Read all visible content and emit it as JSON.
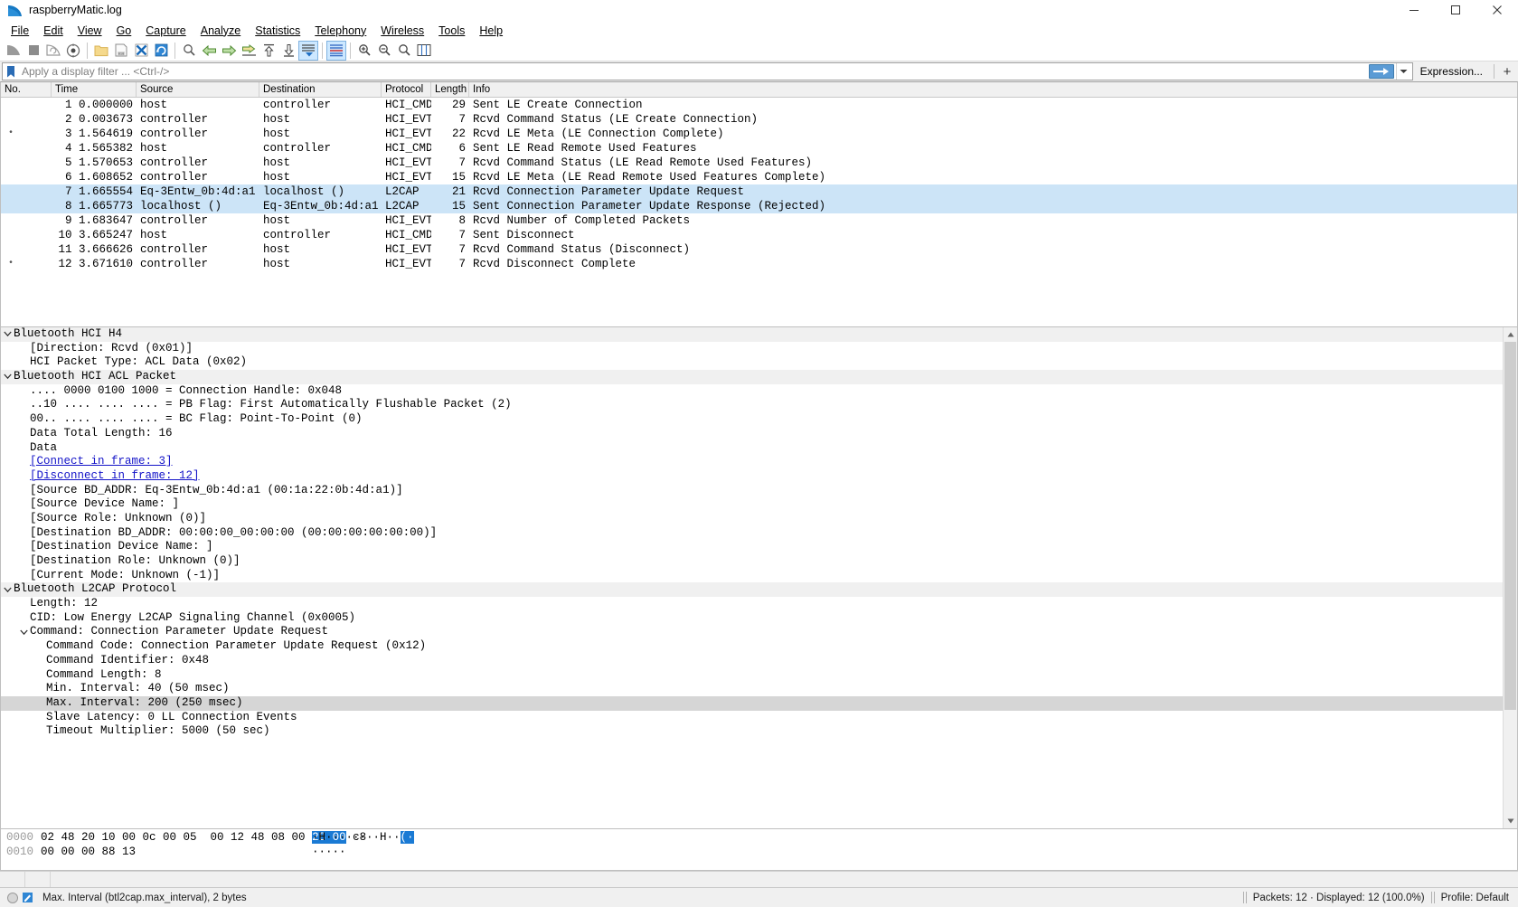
{
  "window": {
    "title": "raspberryMatic.log",
    "icon": "wireshark-shark-fin-icon",
    "minimize_label": "—",
    "maximize_label": "❑",
    "close_label": "✕"
  },
  "menu": {
    "items": [
      {
        "label": "File",
        "accel": "F"
      },
      {
        "label": "Edit",
        "accel": "E"
      },
      {
        "label": "View",
        "accel": "V"
      },
      {
        "label": "Go",
        "accel": "G"
      },
      {
        "label": "Capture",
        "accel": "C"
      },
      {
        "label": "Analyze",
        "accel": "A"
      },
      {
        "label": "Statistics",
        "accel": "S"
      },
      {
        "label": "Telephony",
        "accel": "T"
      },
      {
        "label": "Wireless",
        "accel": "W"
      },
      {
        "label": "Tools",
        "accel": "T"
      },
      {
        "label": "Help",
        "accel": "H"
      }
    ]
  },
  "toolbar": {
    "buttons": [
      {
        "name": "start-capture-icon",
        "title": "Start capturing packets"
      },
      {
        "name": "stop-capture-icon",
        "title": "Stop capturing packets"
      },
      {
        "name": "restart-capture-icon",
        "title": "Restart current capture"
      },
      {
        "name": "capture-options-icon",
        "title": "Capture options"
      },
      {
        "name": "open-file-icon",
        "title": "Open a capture file"
      },
      {
        "name": "save-file-icon",
        "title": "Save this capture file"
      },
      {
        "name": "close-file-icon",
        "title": "Close this capture file"
      },
      {
        "name": "reload-file-icon",
        "title": "Reload this file"
      },
      {
        "name": "find-packet-icon",
        "title": "Find a packet"
      },
      {
        "name": "go-back-icon",
        "title": "Go back in packet history"
      },
      {
        "name": "go-forward-icon",
        "title": "Go forward in packet history"
      },
      {
        "name": "go-to-packet-icon",
        "title": "Go to specific packet"
      },
      {
        "name": "go-first-packet-icon",
        "title": "Go to the first packet"
      },
      {
        "name": "go-last-packet-icon",
        "title": "Go to the last packet"
      },
      {
        "name": "auto-scroll-icon",
        "title": "Auto scroll in live capture"
      },
      {
        "name": "colorize-packets-icon",
        "title": "Colorize packet list"
      },
      {
        "name": "zoom-in-icon",
        "title": "Zoom in"
      },
      {
        "name": "zoom-out-icon",
        "title": "Zoom out"
      },
      {
        "name": "normal-size-icon",
        "title": "Normal size"
      },
      {
        "name": "resize-columns-icon",
        "title": "Resize columns"
      }
    ]
  },
  "filter": {
    "bookmark_icon": "filter-bookmark-icon",
    "placeholder": "Apply a display filter ... <Ctrl-/>",
    "value": "",
    "apply_icon": "apply-filter-arrow-icon",
    "dropdown_icon": "chevron-down-icon",
    "expression_label": "Expression...",
    "add_label": "+"
  },
  "packet_list": {
    "columns": [
      {
        "label": "No."
      },
      {
        "label": "Time"
      },
      {
        "label": "Source"
      },
      {
        "label": "Destination"
      },
      {
        "label": "Protocol"
      },
      {
        "label": "Length"
      },
      {
        "label": "Info"
      }
    ],
    "rows": [
      {
        "mark": "",
        "no": "1",
        "time": "0.000000",
        "source": "host",
        "destination": "controller",
        "protocol": "HCI_CMD",
        "length": "29",
        "info": "Sent LE Create Connection",
        "selected": false
      },
      {
        "mark": "",
        "no": "2",
        "time": "0.003673",
        "source": "controller",
        "destination": "host",
        "protocol": "HCI_EVT",
        "length": "7",
        "info": "Rcvd Command Status (LE Create Connection)",
        "selected": false
      },
      {
        "mark": "•",
        "no": "3",
        "time": "1.564619",
        "source": "controller",
        "destination": "host",
        "protocol": "HCI_EVT",
        "length": "22",
        "info": "Rcvd LE Meta (LE Connection Complete)",
        "selected": false
      },
      {
        "mark": "",
        "no": "4",
        "time": "1.565382",
        "source": "host",
        "destination": "controller",
        "protocol": "HCI_CMD",
        "length": "6",
        "info": "Sent LE Read Remote Used Features",
        "selected": false
      },
      {
        "mark": "",
        "no": "5",
        "time": "1.570653",
        "source": "controller",
        "destination": "host",
        "protocol": "HCI_EVT",
        "length": "7",
        "info": "Rcvd Command Status (LE Read Remote Used Features)",
        "selected": false
      },
      {
        "mark": "",
        "no": "6",
        "time": "1.608652",
        "source": "controller",
        "destination": "host",
        "protocol": "HCI_EVT",
        "length": "15",
        "info": "Rcvd LE Meta (LE Read Remote Used Features Complete)",
        "selected": false
      },
      {
        "mark": "",
        "no": "7",
        "time": "1.665554",
        "source": "Eq-3Entw_0b:4d:a1 ()",
        "destination": "localhost ()",
        "protocol": "L2CAP",
        "length": "21",
        "info": "Rcvd Connection Parameter Update Request",
        "selected": true
      },
      {
        "mark": "",
        "no": "8",
        "time": "1.665773",
        "source": "localhost ()",
        "destination": "Eq-3Entw_0b:4d:a1 ()",
        "protocol": "L2CAP",
        "length": "15",
        "info": "Sent Connection Parameter Update Response (Rejected)",
        "selected": true
      },
      {
        "mark": "",
        "no": "9",
        "time": "1.683647",
        "source": "controller",
        "destination": "host",
        "protocol": "HCI_EVT",
        "length": "8",
        "info": "Rcvd Number of Completed Packets",
        "selected": false
      },
      {
        "mark": "",
        "no": "10",
        "time": "3.665247",
        "source": "host",
        "destination": "controller",
        "protocol": "HCI_CMD",
        "length": "7",
        "info": "Sent Disconnect",
        "selected": false
      },
      {
        "mark": "",
        "no": "11",
        "time": "3.666626",
        "source": "controller",
        "destination": "host",
        "protocol": "HCI_EVT",
        "length": "7",
        "info": "Rcvd Command Status (Disconnect)",
        "selected": false
      },
      {
        "mark": "•",
        "no": "12",
        "time": "3.671610",
        "source": "controller",
        "destination": "host",
        "protocol": "HCI_EVT",
        "length": "7",
        "info": "Rcvd Disconnect Complete",
        "selected": false
      }
    ]
  },
  "packet_detail": {
    "rows": [
      {
        "indent": 0,
        "arrow": "expanded",
        "text": "Bluetooth HCI H4",
        "proto": true,
        "link": false,
        "sel": false
      },
      {
        "indent": 1,
        "arrow": "none",
        "text": "[Direction: Rcvd (0x01)]",
        "proto": false,
        "link": false,
        "sel": false
      },
      {
        "indent": 1,
        "arrow": "none",
        "text": "HCI Packet Type: ACL Data (0x02)",
        "proto": false,
        "link": false,
        "sel": false
      },
      {
        "indent": 0,
        "arrow": "expanded",
        "text": "Bluetooth HCI ACL Packet",
        "proto": true,
        "link": false,
        "sel": false
      },
      {
        "indent": 1,
        "arrow": "none",
        "text": ".... 0000 0100 1000 = Connection Handle: 0x048",
        "proto": false,
        "link": false,
        "sel": false
      },
      {
        "indent": 1,
        "arrow": "none",
        "text": "..10 .... .... .... = PB Flag: First Automatically Flushable Packet (2)",
        "proto": false,
        "link": false,
        "sel": false
      },
      {
        "indent": 1,
        "arrow": "none",
        "text": "00.. .... .... .... = BC Flag: Point-To-Point (0)",
        "proto": false,
        "link": false,
        "sel": false
      },
      {
        "indent": 1,
        "arrow": "none",
        "text": "Data Total Length: 16",
        "proto": false,
        "link": false,
        "sel": false
      },
      {
        "indent": 1,
        "arrow": "none",
        "text": "Data",
        "proto": false,
        "link": false,
        "sel": false
      },
      {
        "indent": 1,
        "arrow": "none",
        "text": "[Connect in frame: 3]",
        "proto": false,
        "link": true,
        "sel": false
      },
      {
        "indent": 1,
        "arrow": "none",
        "text": "[Disconnect in frame: 12]",
        "proto": false,
        "link": true,
        "sel": false
      },
      {
        "indent": 1,
        "arrow": "none",
        "text": "[Source BD_ADDR: Eq-3Entw_0b:4d:a1 (00:1a:22:0b:4d:a1)]",
        "proto": false,
        "link": false,
        "sel": false
      },
      {
        "indent": 1,
        "arrow": "none",
        "text": "[Source Device Name: ]",
        "proto": false,
        "link": false,
        "sel": false
      },
      {
        "indent": 1,
        "arrow": "none",
        "text": "[Source Role: Unknown (0)]",
        "proto": false,
        "link": false,
        "sel": false
      },
      {
        "indent": 1,
        "arrow": "none",
        "text": "[Destination BD_ADDR: 00:00:00_00:00:00 (00:00:00:00:00:00)]",
        "proto": false,
        "link": false,
        "sel": false
      },
      {
        "indent": 1,
        "arrow": "none",
        "text": "[Destination Device Name: ]",
        "proto": false,
        "link": false,
        "sel": false
      },
      {
        "indent": 1,
        "arrow": "none",
        "text": "[Destination Role: Unknown (0)]",
        "proto": false,
        "link": false,
        "sel": false
      },
      {
        "indent": 1,
        "arrow": "none",
        "text": "[Current Mode: Unknown (-1)]",
        "proto": false,
        "link": false,
        "sel": false
      },
      {
        "indent": 0,
        "arrow": "expanded",
        "text": "Bluetooth L2CAP Protocol",
        "proto": true,
        "link": false,
        "sel": false
      },
      {
        "indent": 1,
        "arrow": "none",
        "text": "Length: 12",
        "proto": false,
        "link": false,
        "sel": false
      },
      {
        "indent": 1,
        "arrow": "none",
        "text": "CID: Low Energy L2CAP Signaling Channel (0x0005)",
        "proto": false,
        "link": false,
        "sel": false
      },
      {
        "indent": 1,
        "arrow": "expanded",
        "text": "Command: Connection Parameter Update Request",
        "proto": false,
        "link": false,
        "sel": false
      },
      {
        "indent": 2,
        "arrow": "none",
        "text": "Command Code: Connection Parameter Update Request (0x12)",
        "proto": false,
        "link": false,
        "sel": false
      },
      {
        "indent": 2,
        "arrow": "none",
        "text": "Command Identifier: 0x48",
        "proto": false,
        "link": false,
        "sel": false
      },
      {
        "indent": 2,
        "arrow": "none",
        "text": "Command Length: 8",
        "proto": false,
        "link": false,
        "sel": false
      },
      {
        "indent": 2,
        "arrow": "none",
        "text": "Min. Interval: 40 (50 msec)",
        "proto": false,
        "link": false,
        "sel": false
      },
      {
        "indent": 2,
        "arrow": "none",
        "text": "Max. Interval: 200 (250 msec)",
        "proto": false,
        "link": false,
        "sel": true
      },
      {
        "indent": 2,
        "arrow": "none",
        "text": "Slave Latency: 0 LL Connection Events",
        "proto": false,
        "link": false,
        "sel": false
      },
      {
        "indent": 2,
        "arrow": "none",
        "text": "Timeout Multiplier: 5000 (50 sec)",
        "proto": false,
        "link": false,
        "sel": false
      }
    ]
  },
  "packet_bytes": {
    "rows": [
      {
        "offset": "0000",
        "hex_before": "02 48 20 10 00 0c 00 05  00 12 48 08 00 ",
        "hex_sel": "28 00",
        "hex_after": " c8",
        "ascii_before": "·H········H··",
        "ascii_sel": "(·",
        "ascii_after": ""
      },
      {
        "offset": "0010",
        "hex_before": "00 00 00 88 13",
        "hex_sel": "",
        "hex_after": "",
        "ascii_before": "·····",
        "ascii_sel": "",
        "ascii_after": ""
      }
    ]
  },
  "statusbar": {
    "expert_icon": "expert-info-icon",
    "notes_icon": "capture-file-comment-icon",
    "field_text": "Max. Interval (btl2cap.max_interval), 2 bytes",
    "packets_text": "Packets: 12 · Displayed: 12 (100.0%)",
    "profile_text": "Profile: Default"
  },
  "colors": {
    "selection_blue": "#cce4f7",
    "byte_highlight": "#1a7ad4",
    "field_highlight": "#d6d6d6",
    "link": "#1414c8",
    "proto_row": "#f0f0f0"
  }
}
